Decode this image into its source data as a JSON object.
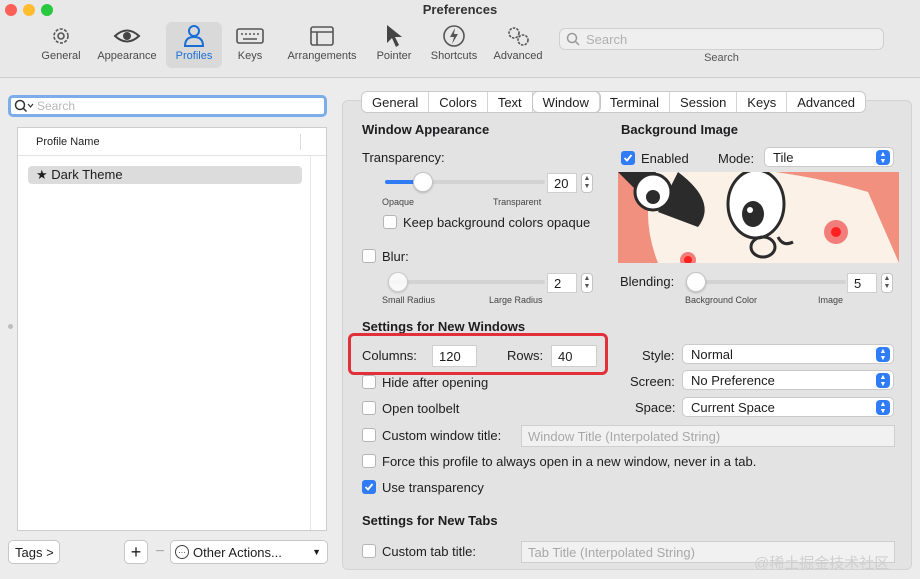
{
  "window": {
    "title": "Preferences"
  },
  "toolbar": {
    "items": [
      {
        "label": "General",
        "icon": "gear-icon"
      },
      {
        "label": "Appearance",
        "icon": "eye-icon"
      },
      {
        "label": "Profiles",
        "icon": "person-icon",
        "active": true
      },
      {
        "label": "Keys",
        "icon": "keyboard-icon"
      },
      {
        "label": "Arrangements",
        "icon": "window-icon"
      },
      {
        "label": "Pointer",
        "icon": "cursor-icon"
      },
      {
        "label": "Shortcuts",
        "icon": "bolt-icon"
      },
      {
        "label": "Advanced",
        "icon": "gears-icon"
      }
    ],
    "search_placeholder": "Search",
    "search_caption": "Search"
  },
  "profiles": {
    "search_placeholder": "Search",
    "column_header": "Profile Name",
    "rows": [
      {
        "name": "Dark Theme",
        "default": true
      }
    ],
    "tags_button": "Tags >",
    "add_label": "+",
    "remove_label": "−",
    "other_actions": "Other Actions..."
  },
  "tabs": [
    {
      "label": "General"
    },
    {
      "label": "Colors"
    },
    {
      "label": "Text"
    },
    {
      "label": "Window",
      "selected": true
    },
    {
      "label": "Terminal"
    },
    {
      "label": "Session"
    },
    {
      "label": "Keys"
    },
    {
      "label": "Advanced"
    }
  ],
  "window_appearance": {
    "heading": "Window Appearance",
    "transparency_label": "Transparency:",
    "transparency_value": "20",
    "transparency_level": 0.2,
    "opaque_label": "Opaque",
    "transparent_label": "Transparent",
    "keep_bg_opaque": {
      "label": "Keep background colors opaque",
      "checked": false
    },
    "blur": {
      "label": "Blur:",
      "checked": false
    },
    "blur_value": "2",
    "blur_level": 0.0,
    "small_radius_label": "Small Radius",
    "large_radius_label": "Large Radius"
  },
  "background_image": {
    "heading": "Background Image",
    "enabled": {
      "label": "Enabled",
      "checked": true
    },
    "mode_label": "Mode:",
    "mode_value": "Tile",
    "blending_label": "Blending:",
    "blending_value": "5",
    "blending_level": 0.0,
    "bg_color_label": "Background Color",
    "image_label": "Image"
  },
  "new_windows": {
    "heading": "Settings for New Windows",
    "columns_label": "Columns:",
    "columns_value": "120",
    "rows_label": "Rows:",
    "rows_value": "40",
    "style_label": "Style:",
    "style_value": "Normal",
    "screen_label": "Screen:",
    "screen_value": "No Preference",
    "space_label": "Space:",
    "space_value": "Current Space",
    "hide_after_opening": {
      "label": "Hide after opening",
      "checked": false
    },
    "open_toolbelt": {
      "label": "Open toolbelt",
      "checked": false
    },
    "custom_title": {
      "label": "Custom window title:",
      "checked": false,
      "placeholder": "Window Title (Interpolated String)"
    },
    "force_new_window": {
      "label": "Force this profile to always open in a new window, never in a tab.",
      "checked": false
    },
    "use_transparency": {
      "label": "Use transparency",
      "checked": true
    }
  },
  "new_tabs": {
    "heading": "Settings for New Tabs",
    "custom_tab_title": {
      "label": "Custom tab title:",
      "checked": false,
      "placeholder": "Tab Title (Interpolated String)"
    }
  },
  "watermark": "@稀土掘金技术社区",
  "colors": {
    "accent": "#2f7cf6",
    "highlight": "#e0303a"
  }
}
